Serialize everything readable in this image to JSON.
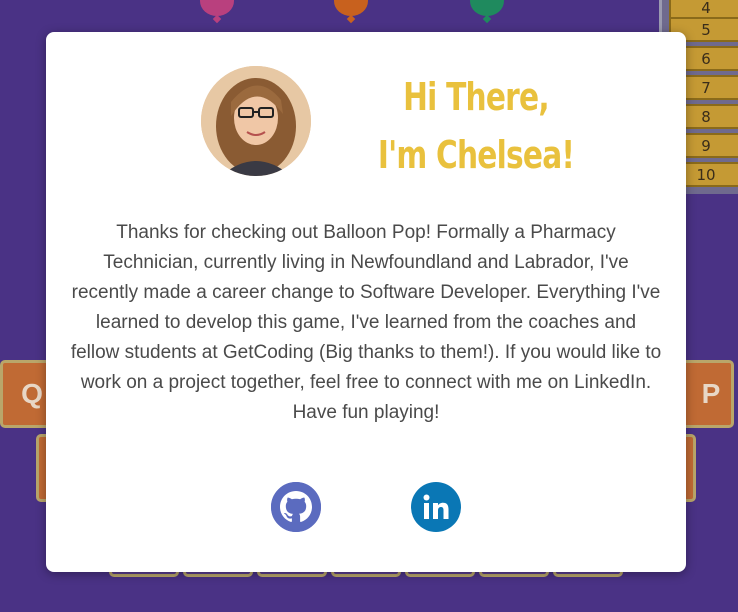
{
  "scoreboard": {
    "rows": [
      "4",
      "5",
      "6",
      "7",
      "8",
      "9",
      "10"
    ]
  },
  "keyboard": {
    "left_key": "Q",
    "right_key": "P"
  },
  "modal": {
    "heading_line1": "Hi There,",
    "heading_line2": "I'm Chelsea!",
    "bio": "Thanks for checking out Balloon Pop! Formally a Pharmacy Technician, currently living in Newfoundland and Labrador, I've recently made a career change to Software Developer. Everything I've learned to develop this game, I've learned from the coaches and fellow students at GetCoding (Big thanks to them!). If you would like to work on a project together, feel free to connect with me on LinkedIn. Have fun playing!",
    "icons": {
      "github": "github-icon",
      "linkedin": "linkedin-icon"
    }
  },
  "colors": {
    "background": "#4a3285",
    "heading": "#e9c13d",
    "github": "#5b6bbf",
    "linkedin": "#0a77b5",
    "key": "#c06a34"
  }
}
